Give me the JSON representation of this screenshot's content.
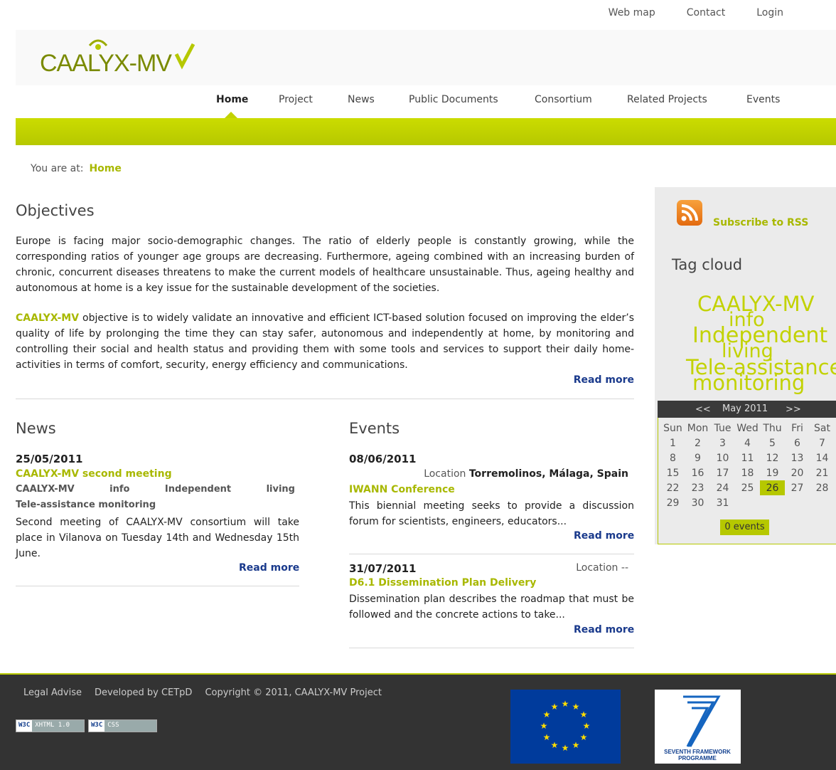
{
  "top_links": [
    "Web map",
    "Contact",
    "Login"
  ],
  "logo_text": "CAALYX-MV",
  "nav": [
    "Home",
    "Project",
    "News",
    "Public Documents",
    "Consortium",
    "Related Projects",
    "Events"
  ],
  "breadcrumb": {
    "label": "You are at:",
    "current": "Home"
  },
  "objectives": {
    "title": "Objectives",
    "p1": "Europe is facing major socio-demographic changes. The ratio of elderly people is constantly growing, while the corresponding ratios of younger age groups are decreasing. Furthermore, ageing combined with an increasing burden of chronic, concurrent diseases threatens to make the current models of healthcare unsustainable. Thus, ageing healthy and autonomous at home is a key issue for the sustainable development of the societies.",
    "p2_brand": "CAALYX-MV",
    "p2_rest": " objective is to widely validate an innovative and efficient ICT-based solution focused on improving the elder’s quality of life by prolonging the time they can stay safer, autonomous and independently at home, by monitoring and controlling their social and health status and providing them with some tools and services to support their daily home-activities in terms of comfort, security, energy efficiency and communications.",
    "read_more": "Read more"
  },
  "news": {
    "title": "News",
    "date": "25/05/2011",
    "headline": "CAALYX-MV second meeting",
    "tags_line1": [
      "CAALYX-MV",
      "info",
      "Independent",
      "living"
    ],
    "tags_line2": "Tele-assistance monitoring",
    "body": "Second meeting of CAALYX-MV consortium will take place in Vilanova on Tuesday 14th and Wednesday 15th June.",
    "read_more": "Read more"
  },
  "events": {
    "title": "Events",
    "items": [
      {
        "date": "08/06/2011",
        "location_label": "Location",
        "location": "Torremolinos, Málaga, Spain",
        "name": "IWANN Conference",
        "body": "This biennial meeting seeks to provide a discussion forum for scientists, engineers, educators...",
        "read_more": "Read more"
      },
      {
        "date": "31/07/2011",
        "location_label": "Location",
        "location": "--",
        "name": "D6.1 Dissemination Plan Delivery",
        "body": "Dissemination plan describes the roadmap that must be followed and the concrete actions to take...",
        "read_more": "Read more"
      }
    ]
  },
  "sidebar": {
    "rss": "Subscribe to RSS",
    "tag_cloud_title": "Tag cloud",
    "tags": [
      "CAALYX-MV",
      "info",
      "Independent",
      "living",
      "Tele-assistance",
      "monitoring"
    ],
    "calendar": {
      "prev": "<<",
      "month": "May 2011",
      "next": ">>",
      "weekdays": [
        "Sun",
        "Mon",
        "Tue",
        "Wed",
        "Thu",
        "Fri",
        "Sat"
      ],
      "weeks": [
        [
          "1",
          "2",
          "3",
          "4",
          "5",
          "6",
          "7"
        ],
        [
          "8",
          "9",
          "10",
          "11",
          "12",
          "13",
          "14"
        ],
        [
          "15",
          "16",
          "17",
          "18",
          "19",
          "20",
          "21"
        ],
        [
          "22",
          "23",
          "24",
          "25",
          "26",
          "27",
          "28"
        ],
        [
          "29",
          "30",
          "31",
          "",
          "",
          "",
          ""
        ]
      ],
      "today": "26",
      "events_button": "0 events"
    }
  },
  "footer": {
    "links": [
      "Legal Advise",
      "Developed by CETpD",
      "Copyright © 2011, CAALYX-MV Project"
    ],
    "badges": [
      {
        "left": "W3C",
        "right": "XHTML 1.0"
      },
      {
        "left": "W3C",
        "right": "CSS"
      }
    ],
    "fp7_text": [
      "SEVENTH FRAMEWORK",
      "PROGRAMME"
    ]
  },
  "colors": {
    "accent": "#b6c800",
    "link": "#1a3a8c",
    "footer_bg": "#333333"
  }
}
